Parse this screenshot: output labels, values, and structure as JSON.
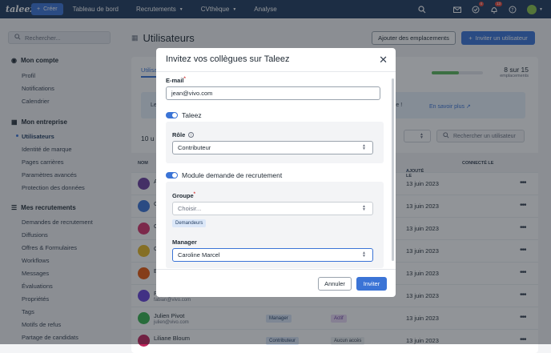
{
  "topbar": {
    "logo": "taleez",
    "create_label": "Créer",
    "nav": [
      "Tableau de bord",
      "Recrutements",
      "CVthèque",
      "Analyse"
    ],
    "badges": {
      "tasks": "4",
      "notifications": "13"
    }
  },
  "sidebar": {
    "search_placeholder": "Rechercher...",
    "sections": [
      {
        "title": "Mon compte",
        "items": [
          "Profil",
          "Notifications",
          "Calendrier"
        ]
      },
      {
        "title": "Mon entreprise",
        "items": [
          "Utilisateurs",
          "Identité de marque",
          "Pages carrières",
          "Paramètres avancés",
          "Protection des données"
        ]
      },
      {
        "title": "Mes recrutements",
        "items": [
          "Demandes de recrutement",
          "Diffusions",
          "Offres & Formulaires",
          "Workflows",
          "Messages",
          "Évaluations",
          "Propriétés",
          "Tags",
          "Motifs de refus",
          "Partage de candidats"
        ]
      }
    ]
  },
  "main": {
    "title": "Utilisateurs",
    "add_locations": "Ajouter des emplacements",
    "invite_user": "Inviter un utilisateur",
    "tab": "Utilisateurs",
    "usage": {
      "count": "8 sur 15",
      "unit": "emplacements",
      "fraction": 0.53
    },
    "info_start": "Le",
    "info_end": "un espace !",
    "info_link": "En savoir plus",
    "count_label": "10 u",
    "search_user_placeholder": "Rechercher un utilisateur",
    "columns": {
      "name": "NOM",
      "added": "AJOUTÉ LE",
      "connected": "CONNECTÉ LE"
    },
    "rows": [
      {
        "name": "A",
        "email": "",
        "role": "",
        "status": "",
        "date": "13 juin 2023",
        "color": "#6b3fa0"
      },
      {
        "name": "C",
        "email": "",
        "role": "",
        "status": "",
        "date": "13 juin 2023",
        "color": "#3b74d6"
      },
      {
        "name": "C",
        "email": "",
        "role": "",
        "status": "",
        "date": "13 juin 2023",
        "color": "#d6336c"
      },
      {
        "name": "C",
        "email": "",
        "role": "",
        "status": "",
        "date": "13 juin 2023",
        "color": "#e8b923"
      },
      {
        "name": "E",
        "email": "",
        "role": "",
        "status": "",
        "date": "13 juin 2023",
        "color": "#e8590c"
      },
      {
        "name": "F",
        "email": "fabian@vivo.com",
        "role": "",
        "status": "",
        "date": "13 juin 2023",
        "color": "#6741d9"
      },
      {
        "name": "Julien Pivot",
        "email": "julien@vivo.com",
        "role": "Manager",
        "status": "Actif",
        "date": "13 juin 2023",
        "color": "#37b24d"
      },
      {
        "name": "Liliane Bloum",
        "email": "",
        "role": "Contributeur",
        "status": "Aucun accès",
        "date": "13 juin 2023",
        "color": "#c2255c"
      }
    ]
  },
  "modal": {
    "title": "Invitez vos collègues sur Taleez",
    "email_label": "E-mail",
    "email_value": "jean@vivo.com",
    "taleez_toggle": "Taleez",
    "role_label": "Rôle",
    "role_value": "Contributeur",
    "module_toggle": "Module demande de recrutement",
    "group_label": "Groupe",
    "group_placeholder": "Choisir...",
    "group_chip": "Demandeurs",
    "manager_label": "Manager",
    "manager_value": "Caroline Marcel",
    "cancel": "Annuler",
    "invite": "Inviter"
  }
}
